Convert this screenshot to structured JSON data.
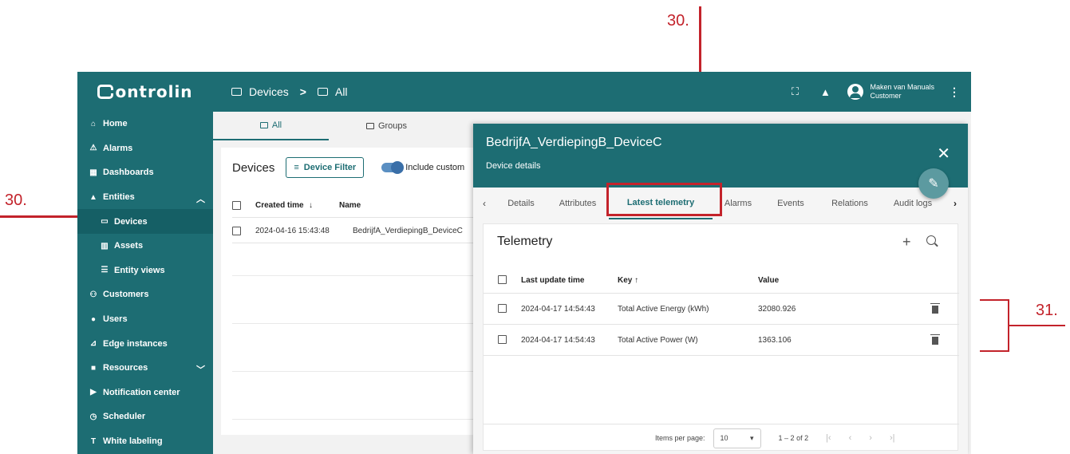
{
  "annotations": {
    "top_label": "30.",
    "left_label": "30.",
    "right_label": "31."
  },
  "colors": {
    "brand": "#1d6d73",
    "annotation": "#c3232b"
  },
  "app": {
    "logo": "ontrolin",
    "breadcrumb": {
      "first": "Devices",
      "sep": ">",
      "second": "All"
    },
    "user": {
      "name": "Maken van Manuals",
      "role": "Customer"
    }
  },
  "sidebar": {
    "items": [
      {
        "label": "Home",
        "icon": "home-icon"
      },
      {
        "label": "Alarms",
        "icon": "warning-icon"
      },
      {
        "label": "Dashboards",
        "icon": "dashboard-icon"
      },
      {
        "label": "Entities",
        "icon": "entities-icon"
      },
      {
        "label": "Devices",
        "icon": "device-icon"
      },
      {
        "label": "Assets",
        "icon": "asset-icon"
      },
      {
        "label": "Entity views",
        "icon": "entity-view-icon"
      },
      {
        "label": "Customers",
        "icon": "customers-icon"
      },
      {
        "label": "Users",
        "icon": "user-icon"
      },
      {
        "label": "Edge instances",
        "icon": "edge-icon"
      },
      {
        "label": "Resources",
        "icon": "folder-icon"
      },
      {
        "label": "Notification center",
        "icon": "notification-icon"
      },
      {
        "label": "Scheduler",
        "icon": "clock-icon"
      },
      {
        "label": "White labeling",
        "icon": "paint-icon"
      }
    ]
  },
  "main": {
    "tabs": [
      "All",
      "Groups"
    ],
    "devices_title": "Devices",
    "filter_label": "Device Filter",
    "include_label": "Include custom",
    "columns": {
      "created": "Created time",
      "name": "Name"
    },
    "row": {
      "created": "2024-04-16 15:43:48",
      "name": "BedrijfA_VerdiepingB_DeviceC"
    }
  },
  "modal": {
    "title": "BedrijfA_VerdiepingB_DeviceC",
    "subtitle": "Device details",
    "tabs": [
      "Details",
      "Attributes",
      "Latest telemetry",
      "Alarms",
      "Events",
      "Relations",
      "Audit logs"
    ],
    "telemetry_title": "Telemetry",
    "columns": {
      "time": "Last update time",
      "key": "Key",
      "value": "Value"
    },
    "rows": [
      {
        "time": "2024-04-17 14:54:43",
        "key": "Total Active Energy (kWh)",
        "value": "32080.926"
      },
      {
        "time": "2024-04-17 14:54:43",
        "key": "Total Active Power (W)",
        "value": "1363.106"
      }
    ],
    "pager": {
      "label": "Items per page:",
      "per_page": "10",
      "range": "1 – 2 of 2"
    }
  }
}
